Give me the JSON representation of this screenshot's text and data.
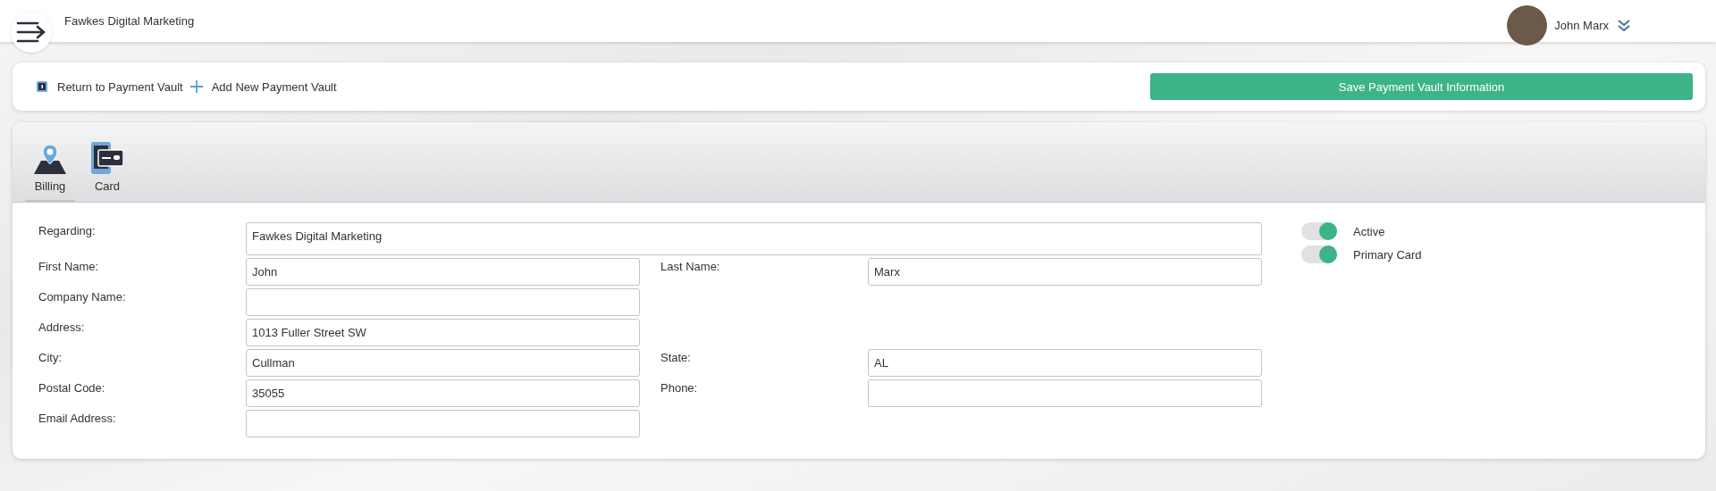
{
  "header": {
    "title": "Fawkes Digital Marketing",
    "user": "John Marx"
  },
  "toolbar": {
    "links": [
      {
        "kind": "return",
        "label": "Return to Payment Vault"
      },
      {
        "kind": "add",
        "label": "Add New Payment Vault"
      }
    ],
    "save_button": "Save Payment Vault Information"
  },
  "tabs": [
    {
      "kind": "billing",
      "label": "Billing",
      "selected": true
    },
    {
      "kind": "card",
      "label": "Card",
      "selected": false
    }
  ],
  "form": {
    "rows": [
      {
        "kind": "wide",
        "left": {
          "label": "Regarding:",
          "value": "Fawkes Digital Marketing"
        }
      },
      {
        "kind": "pair",
        "left": {
          "label": "First Name:",
          "value": "John"
        },
        "right": {
          "label": "Last Name:",
          "value": "Marx"
        }
      },
      {
        "kind": "pair",
        "left": {
          "label": "Company Name:"
        }
      },
      {
        "kind": "pair",
        "left": {
          "label": "Address:",
          "value": "1013 Fuller Street SW"
        }
      },
      {
        "kind": "pair",
        "left": {
          "label": "City:",
          "value": "Cullman"
        },
        "right": {
          "label": "State:",
          "value": "AL"
        }
      },
      {
        "kind": "pair",
        "left": {
          "label": "Postal Code:",
          "value": "35055"
        },
        "right": {
          "label": "Phone:"
        }
      },
      {
        "kind": "pair",
        "left": {
          "label": "Email Address:"
        }
      }
    ],
    "toggles": [
      {
        "label": "Active",
        "on": true
      },
      {
        "label": "Primary Card",
        "on": true
      }
    ]
  }
}
